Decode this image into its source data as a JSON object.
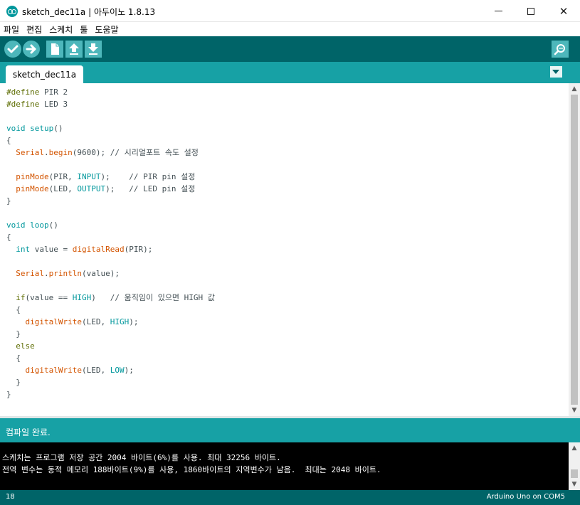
{
  "window": {
    "title": "sketch_dec11a | 아두이노 1.8.13",
    "minimize_icon": "minimize-icon",
    "maximize_icon": "maximize-icon",
    "close_label": "✕"
  },
  "menu": [
    "파일",
    "편집",
    "스케치",
    "툴",
    "도움말"
  ],
  "toolbar": {
    "buttons": [
      "verify-icon",
      "upload-icon",
      "new-icon",
      "open-icon",
      "save-icon"
    ],
    "serial_monitor": "serial-monitor-icon",
    "accent": "#4db7bb",
    "background": "#006468"
  },
  "tabs": [
    {
      "label": "sketch_dec11a",
      "active": true
    }
  ],
  "code_lines": [
    [
      {
        "t": "#define",
        "c": "kw-dir"
      },
      {
        "t": " PIR 2"
      }
    ],
    [
      {
        "t": "#define",
        "c": "kw-dir"
      },
      {
        "t": " LED 3"
      }
    ],
    [],
    [
      {
        "t": "void",
        "c": "kw-type"
      },
      {
        "t": " "
      },
      {
        "t": "setup",
        "c": "kw-type"
      },
      {
        "t": "()"
      }
    ],
    [
      {
        "t": "{"
      }
    ],
    [
      {
        "t": "  "
      },
      {
        "t": "Serial",
        "c": "kw-func"
      },
      {
        "t": "."
      },
      {
        "t": "begin",
        "c": "kw-func"
      },
      {
        "t": "(9600); // 시리얼포트 속도 설정"
      }
    ],
    [],
    [
      {
        "t": "  "
      },
      {
        "t": "pinMode",
        "c": "kw-func"
      },
      {
        "t": "(PIR, "
      },
      {
        "t": "INPUT",
        "c": "kw-const"
      },
      {
        "t": ");    // PIR pin 설정"
      }
    ],
    [
      {
        "t": "  "
      },
      {
        "t": "pinMode",
        "c": "kw-func"
      },
      {
        "t": "(LED, "
      },
      {
        "t": "OUTPUT",
        "c": "kw-const"
      },
      {
        "t": ");   // LED pin 설정"
      }
    ],
    [
      {
        "t": "}"
      }
    ],
    [],
    [
      {
        "t": "void",
        "c": "kw-type"
      },
      {
        "t": " "
      },
      {
        "t": "loop",
        "c": "kw-type"
      },
      {
        "t": "()"
      }
    ],
    [
      {
        "t": "{"
      }
    ],
    [
      {
        "t": "  "
      },
      {
        "t": "int",
        "c": "kw-type"
      },
      {
        "t": " value = "
      },
      {
        "t": "digitalRead",
        "c": "kw-func"
      },
      {
        "t": "(PIR);"
      }
    ],
    [],
    [
      {
        "t": "  "
      },
      {
        "t": "Serial",
        "c": "kw-func"
      },
      {
        "t": "."
      },
      {
        "t": "println",
        "c": "kw-func"
      },
      {
        "t": "(value);"
      }
    ],
    [],
    [
      {
        "t": "  "
      },
      {
        "t": "if",
        "c": "kw-dir"
      },
      {
        "t": "(value == "
      },
      {
        "t": "HIGH",
        "c": "kw-const"
      },
      {
        "t": ")   // 움직임이 있으면 HIGH 값"
      }
    ],
    [
      {
        "t": "  {"
      }
    ],
    [
      {
        "t": "    "
      },
      {
        "t": "digitalWrite",
        "c": "kw-func"
      },
      {
        "t": "(LED, "
      },
      {
        "t": "HIGH",
        "c": "kw-const"
      },
      {
        "t": ");"
      }
    ],
    [
      {
        "t": "  }"
      }
    ],
    [
      {
        "t": "  "
      },
      {
        "t": "else",
        "c": "kw-dir"
      }
    ],
    [
      {
        "t": "  {"
      }
    ],
    [
      {
        "t": "    "
      },
      {
        "t": "digitalWrite",
        "c": "kw-func"
      },
      {
        "t": "(LED, "
      },
      {
        "t": "LOW",
        "c": "kw-const"
      },
      {
        "t": ");"
      }
    ],
    [
      {
        "t": "  }"
      }
    ],
    [
      {
        "t": "}"
      }
    ]
  ],
  "status": {
    "message": "컴파일 완료."
  },
  "console": {
    "lines": [
      "스케치는 프로그램 저장 공간 2004 바이트(6%)를 사용. 최대 32256 바이트.",
      "전역 변수는 동적 메모리 188바이트(9%)를 사용, 1860바이트의 지역변수가 남음.  최대는 2048 바이트."
    ]
  },
  "footer": {
    "line_number": "18",
    "board": "Arduino Uno on COM5"
  },
  "scroll": {
    "up_icon": "scroll-up-icon",
    "down_icon": "scroll-down-icon"
  }
}
